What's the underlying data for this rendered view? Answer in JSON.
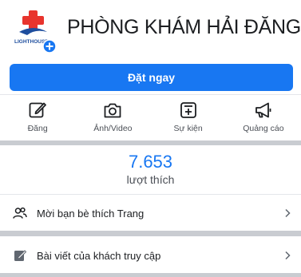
{
  "header": {
    "page_name": "PHÒNG KHÁM HẢI ĐĂNG",
    "logo_text": "LIGHTHOUSE"
  },
  "book_button": {
    "label": "Đặt ngay"
  },
  "actions": [
    {
      "label": "Đăng",
      "icon": "edit-icon"
    },
    {
      "label": "Ảnh/Video",
      "icon": "camera-icon"
    },
    {
      "label": "Sự kiện",
      "icon": "calendar-plus-icon"
    },
    {
      "label": "Quảng cáo",
      "icon": "megaphone-icon"
    }
  ],
  "likes": {
    "count": "7.653",
    "label": "lượt thích"
  },
  "rows": [
    {
      "label": "Mời bạn bè thích Trang",
      "icon": "invite-friends-icon"
    },
    {
      "label": "Bài viết của khách truy cập",
      "icon": "visitor-post-icon"
    }
  ],
  "colors": {
    "accent": "#1877f2",
    "divider": "#c9ccd1",
    "logo_red": "#e8342d",
    "logo_blue": "#1e4e9e"
  }
}
